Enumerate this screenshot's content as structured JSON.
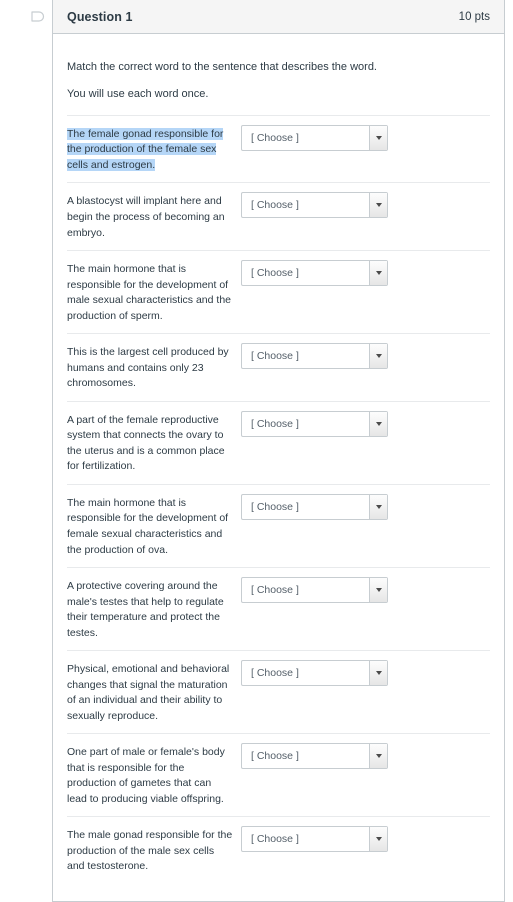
{
  "header": {
    "flag_icon": "flag-outline-icon",
    "title": "Question 1",
    "points": "10 pts"
  },
  "intro": {
    "line1": "Match the correct word to the sentence that describes the word.",
    "line2": "You will use each word once."
  },
  "select": {
    "placeholder": "[ Choose ]",
    "caret_icon": "chevron-down-icon"
  },
  "colors": {
    "highlight": "#b5d6f7",
    "border": "#c7cdd1",
    "divider": "#e8eaec",
    "header_bg": "#f5f5f5",
    "text": "#2d3b45"
  },
  "rows": [
    {
      "prompt": "The female gonad responsible for the production of the female sex cells and estrogen.",
      "highlighted": true,
      "value": "[ Choose ]"
    },
    {
      "prompt": "A blastocyst will implant here and begin the process of becoming an embryo.",
      "highlighted": false,
      "value": "[ Choose ]"
    },
    {
      "prompt": "The main hormone that is responsible for the development of male sexual characteristics and the production of sperm.",
      "highlighted": false,
      "value": "[ Choose ]"
    },
    {
      "prompt": "This is the largest cell produced by humans and contains only 23 chromosomes.",
      "highlighted": false,
      "value": "[ Choose ]"
    },
    {
      "prompt": "A part of the female reproductive system that connects the ovary to the uterus and is a common place for fertilization.",
      "highlighted": false,
      "value": "[ Choose ]"
    },
    {
      "prompt": "The main hormone that is responsible for the development of female sexual characteristics and the production of ova.",
      "highlighted": false,
      "value": "[ Choose ]"
    },
    {
      "prompt": "A protective covering around the male's testes that help to regulate their temperature and protect the testes.",
      "highlighted": false,
      "value": "[ Choose ]"
    },
    {
      "prompt": "Physical, emotional and behavioral changes that signal the maturation of an individual and their ability to sexually reproduce.",
      "highlighted": false,
      "value": "[ Choose ]"
    },
    {
      "prompt": "One part of male or female's body that is responsible for the production of gametes that can lead to producing viable offspring.",
      "highlighted": false,
      "value": "[ Choose ]"
    },
    {
      "prompt": "The male gonad responsible for the production of the male sex cells and testosterone.",
      "highlighted": false,
      "value": "[ Choose ]"
    }
  ]
}
